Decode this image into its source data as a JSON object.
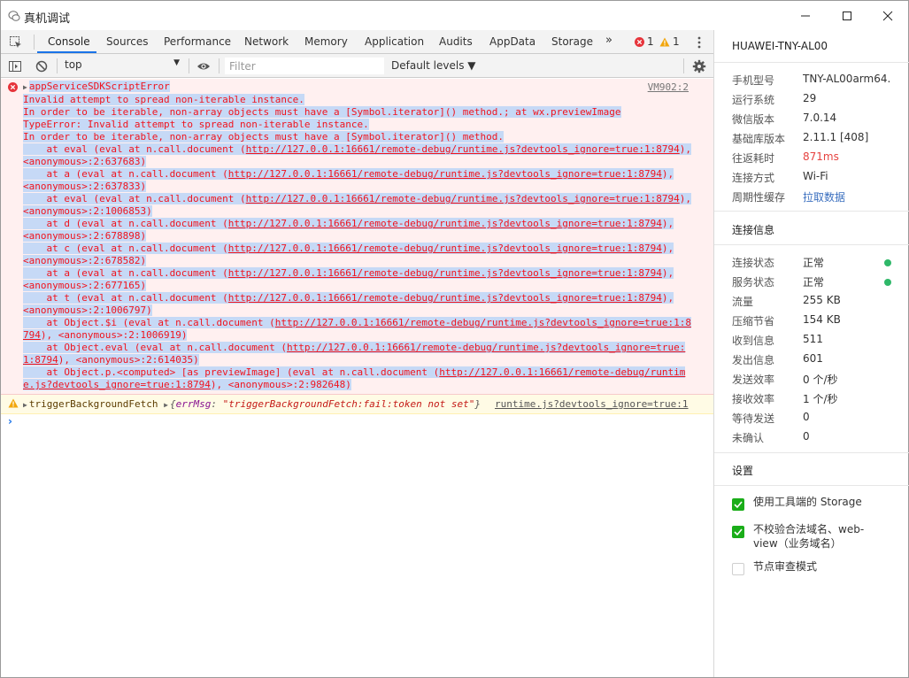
{
  "window": {
    "title": "真机调试"
  },
  "tabs": {
    "items": [
      "Console",
      "Sources",
      "Performance",
      "Network",
      "Memory",
      "Application",
      "Audits",
      "AppData",
      "Storage"
    ],
    "more": "»",
    "error_count": "1",
    "warning_count": "1"
  },
  "toolbar": {
    "context": "top",
    "filter_placeholder": "Filter",
    "levels": "Default levels ▼"
  },
  "console": {
    "error": {
      "source": "VM902:2",
      "title": "appServiceSDKScriptError",
      "line1": "Invalid attempt to spread non-iterable instance.",
      "line2": "In order to be iterable, non-array objects must have a [Symbol.iterator]() method.; at wx.previewImage",
      "line3": "TypeError: Invalid attempt to spread non-iterable instance.",
      "line4": "In order to be iterable, non-array objects must have a [Symbol.iterator]() method.",
      "frames": [
        {
          "pre": "    at eval (eval at n.call.document (",
          "url": "http://127.0.0.1:16661/remote-debug/runtime.js?devtools_ignore=true:1:8794",
          "post": "),",
          "cont": "<anonymous>:2:637683)"
        },
        {
          "pre": "    at a (eval at n.call.document (",
          "url": "http://127.0.0.1:16661/remote-debug/runtime.js?devtools_ignore=true:1:8794",
          "post": "),",
          "cont": "<anonymous>:2:637833)"
        },
        {
          "pre": "    at eval (eval at n.call.document (",
          "url": "http://127.0.0.1:16661/remote-debug/runtime.js?devtools_ignore=true:1:8794",
          "post": "),",
          "cont": "<anonymous>:2:1006853)"
        },
        {
          "pre": "    at d (eval at n.call.document (",
          "url": "http://127.0.0.1:16661/remote-debug/runtime.js?devtools_ignore=true:1:8794",
          "post": "),",
          "cont": "<anonymous>:2:678898)"
        },
        {
          "pre": "    at c (eval at n.call.document (",
          "url": "http://127.0.0.1:16661/remote-debug/runtime.js?devtools_ignore=true:1:8794",
          "post": "),",
          "cont": "<anonymous>:2:678582)"
        },
        {
          "pre": "    at a (eval at n.call.document (",
          "url": "http://127.0.0.1:16661/remote-debug/runtime.js?devtools_ignore=true:1:8794",
          "post": "),",
          "cont": "<anonymous>:2:677165)"
        },
        {
          "pre": "    at t (eval at n.call.document (",
          "url": "http://127.0.0.1:16661/remote-debug/runtime.js?devtools_ignore=true:1:8794",
          "post": "),",
          "cont": "<anonymous>:2:1006797)"
        }
      ],
      "frame8_a": "    at Object.$i (eval at n.call.document (",
      "frame8_url_a": "http://127.0.0.1:16661/remote-debug/runtime.js?devtools_ignore=true:1:8",
      "frame8_url_b": "794",
      "frame8_b": "), <anonymous>:2:1006919)",
      "frame9_a": "    at Object.eval (eval at n.call.document (",
      "frame9_url_a": "http://127.0.0.1:16661/remote-debug/runtime.js?devtools_ignore=true:",
      "frame9_url_b": "1:8794",
      "frame9_b": "), <anonymous>:2:614035)",
      "frame10_a": "    at Object.p.<computed> [as previewImage] (eval at n.call.document (",
      "frame10_url_a": "http://127.0.0.1:16661/remote-debug/runtim",
      "frame10_url_b": "e.js?devtools_ignore=true:1:8794",
      "frame10_b": "), <anonymous>:2:982648)"
    },
    "warning": {
      "name": "triggerBackgroundFetch",
      "obj_key": "errMsg",
      "obj_val": "\"triggerBackgroundFetch:fail:token not set\"",
      "source": "runtime.js?devtools_ignore=true:1"
    },
    "prompt": "›"
  },
  "sidebar": {
    "device_name": "HUAWEI-TNY-AL00",
    "info": [
      {
        "k": "手机型号",
        "v": "TNY-AL00arm64..."
      },
      {
        "k": "运行系统",
        "v": "29"
      },
      {
        "k": "微信版本",
        "v": "7.0.14"
      },
      {
        "k": "基础库版本",
        "v": "2.11.1 [408]"
      },
      {
        "k": "往返耗时",
        "v": "871ms"
      },
      {
        "k": "连接方式",
        "v": "Wi-Fi"
      },
      {
        "k": "周期性缓存",
        "v": "拉取数据"
      }
    ],
    "conn_title": "连接信息",
    "conn": [
      {
        "k": "连接状态",
        "v": "正常"
      },
      {
        "k": "服务状态",
        "v": "正常"
      },
      {
        "k": "流量",
        "v": "255 KB"
      },
      {
        "k": "压缩节省",
        "v": "154 KB"
      },
      {
        "k": "收到信息",
        "v": "511"
      },
      {
        "k": "发出信息",
        "v": "601"
      },
      {
        "k": "发送效率",
        "v": "0 个/秒"
      },
      {
        "k": "接收效率",
        "v": "1 个/秒"
      },
      {
        "k": "等待发送",
        "v": "0"
      },
      {
        "k": "未确认",
        "v": "0"
      }
    ],
    "settings_title": "设置",
    "settings": [
      {
        "label": "使用工具端的 Storage",
        "checked": true
      },
      {
        "label": "不校验合法域名、web-view（业务域名）",
        "checked": true
      },
      {
        "label": "节点审查模式",
        "checked": false
      }
    ],
    "colors": {
      "ok_dot": "#2fb869",
      "check_green": "#1aad19",
      "rtt_red": "#e64340",
      "link_blue": "#3b6fbf"
    }
  }
}
